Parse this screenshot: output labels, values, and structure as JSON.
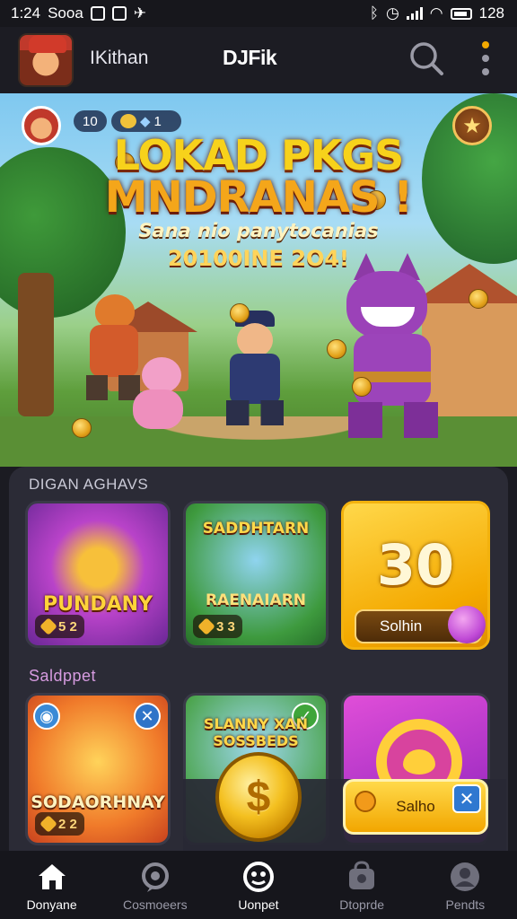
{
  "status_bar": {
    "time": "1:24",
    "carrier": "Sooa",
    "right_text": "128"
  },
  "header": {
    "username": "IKithan",
    "app_title": "DJFik"
  },
  "hero": {
    "line1": "LOKAD PKGS",
    "line2": "MNDRANAS !",
    "line3": "Sana nio panytocanias",
    "line4": "20100INE 2O4!",
    "level": "10",
    "coins": "1"
  },
  "sections": {
    "first": "DIGAN AGHAVS",
    "second": "Saldppet"
  },
  "cards": [
    {
      "title": "PUNDANY",
      "badge": "5 2"
    },
    {
      "title": "SADDHTARN",
      "subtitle": "RAENAIARN",
      "badge": "3 3"
    },
    {
      "big_number": "30",
      "button": "Solhin"
    },
    {
      "title": "SODAORHNAY",
      "badge": "2 2"
    },
    {
      "title": "SLANNY XAN SOSSBEDS"
    },
    {}
  ],
  "dock": {
    "coin_symbol": "$",
    "button": "Salho"
  },
  "bottom_nav": [
    {
      "label": "Donyane",
      "icon": "home-icon",
      "active": true
    },
    {
      "label": "Cosmoeers",
      "icon": "chat-icon",
      "active": false
    },
    {
      "label": "Uonpet",
      "icon": "controller-icon",
      "active": true
    },
    {
      "label": "Dtoprde",
      "icon": "shop-icon",
      "active": false
    },
    {
      "label": "Pendts",
      "icon": "profile-icon",
      "active": false
    }
  ],
  "colors": {
    "accent": "#f2a900",
    "panel": "#2b2b36",
    "background": "#1b1b22"
  }
}
